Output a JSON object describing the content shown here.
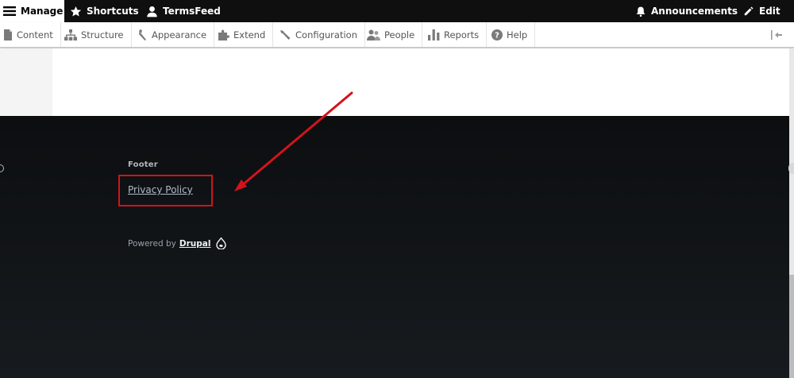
{
  "toolbar": {
    "manage_label": "Manage",
    "shortcuts_label": "Shortcuts",
    "user_label": "TermsFeed",
    "announcements_label": "Announcements",
    "edit_label": "Edit"
  },
  "tray": {
    "items": [
      {
        "label": "Content",
        "icon": "document-icon"
      },
      {
        "label": "Structure",
        "icon": "sitemap-icon"
      },
      {
        "label": "Appearance",
        "icon": "brush-icon"
      },
      {
        "label": "Extend",
        "icon": "puzzle-icon"
      },
      {
        "label": "Configuration",
        "icon": "wrench-icon"
      },
      {
        "label": "People",
        "icon": "people-icon"
      },
      {
        "label": "Reports",
        "icon": "bar-chart-icon"
      },
      {
        "label": "Help",
        "icon": "help-icon"
      }
    ]
  },
  "footer": {
    "heading": "Footer",
    "privacy_link": "Privacy Policy",
    "powered_by": "Powered by",
    "drupal_link": "Drupal"
  },
  "colors": {
    "toolbar_bg": "#0f0f0f",
    "footer_bg": "#12161a",
    "highlight": "#d3131b"
  }
}
